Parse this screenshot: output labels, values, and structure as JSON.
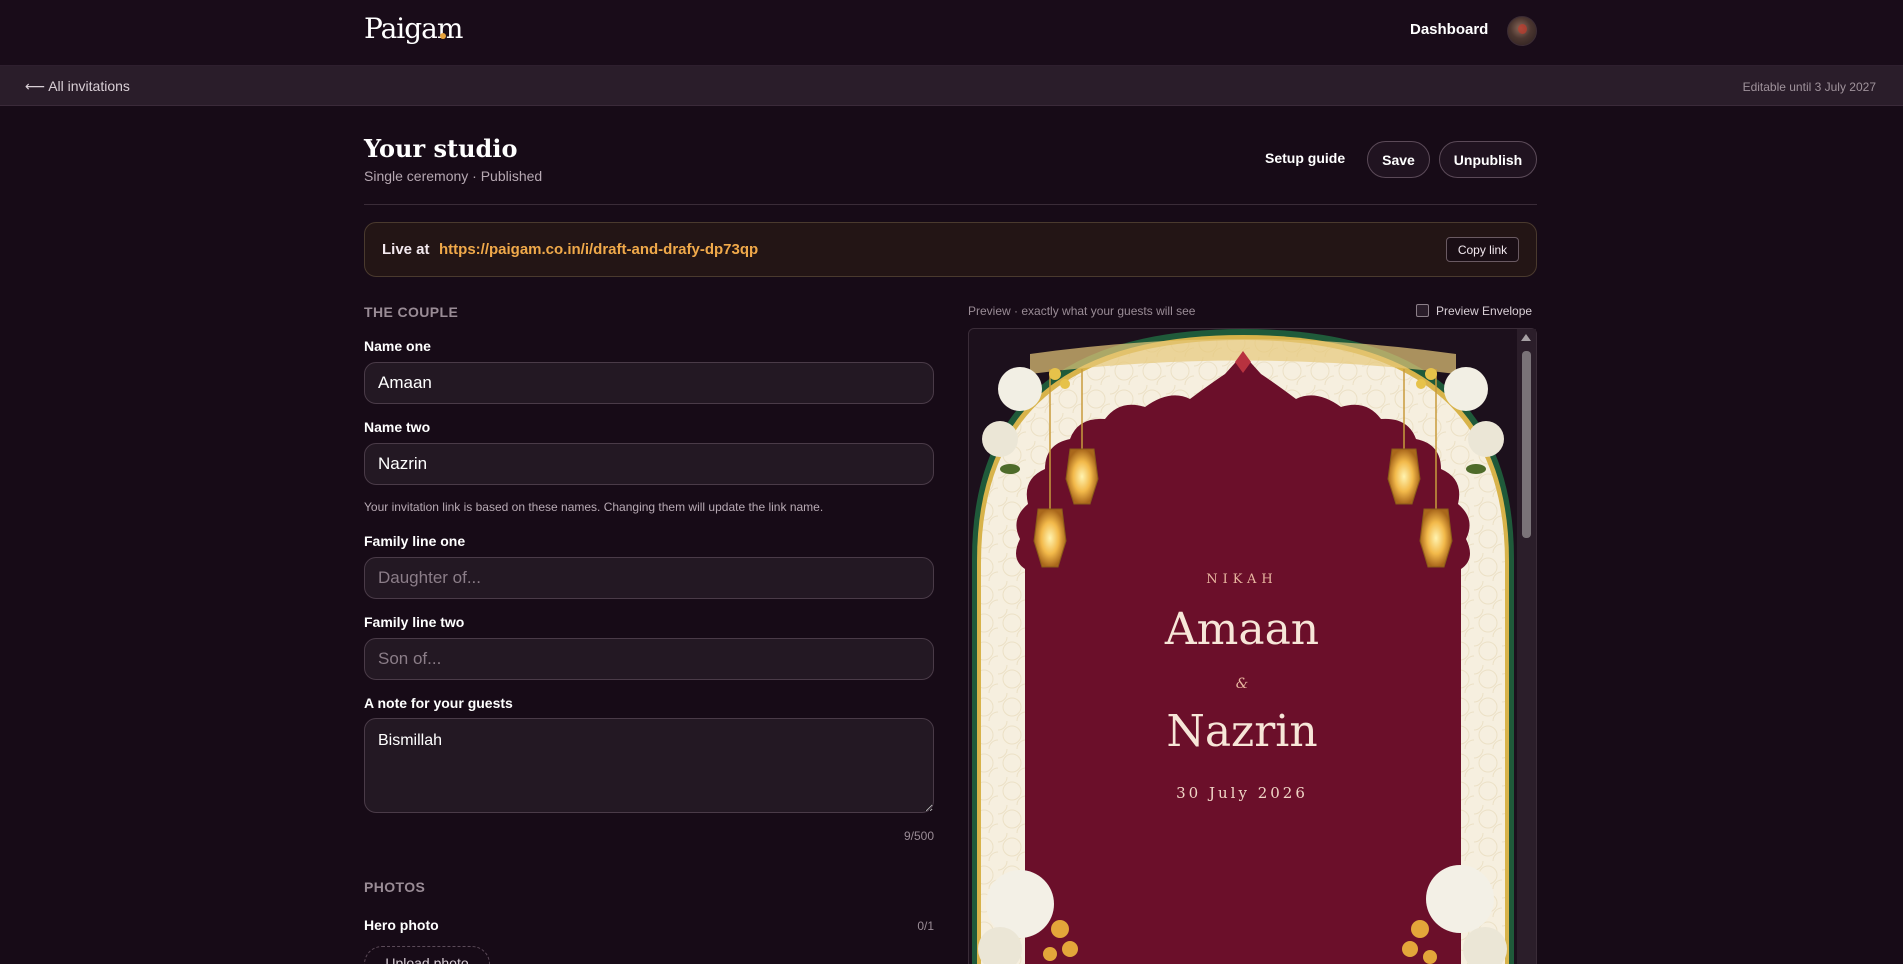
{
  "nav": {
    "logo": "Paigam",
    "dashboard": "Dashboard"
  },
  "subbar": {
    "back": "⟵ All invitations",
    "editable": "Editable until 3 July 2027"
  },
  "header": {
    "title": "Your studio",
    "subtitle": "Single ceremony · Published",
    "setup_guide": "Setup guide",
    "save": "Save",
    "unpublish": "Unpublish"
  },
  "live": {
    "label": "Live at",
    "url": "https://paigam.co.in/i/draft-and-drafy-dp73qp",
    "copy": "Copy link"
  },
  "couple": {
    "heading": "THE COUPLE",
    "name_one_label": "Name one",
    "name_one_value": "Amaan",
    "name_two_label": "Name two",
    "name_two_value": "Nazrin",
    "helper": "Your invitation link is based on these names. Changing them will update the link name.",
    "family_one_label": "Family line one",
    "family_one_placeholder": "Daughter of...",
    "family_two_label": "Family line two",
    "family_two_placeholder": "Son of...",
    "note_label": "A note for your guests",
    "note_value": "Bismillah",
    "note_count": "9/500"
  },
  "photos": {
    "heading": "PHOTOS",
    "hero_label": "Hero photo",
    "hero_count": "0/1",
    "upload": "Upload photo"
  },
  "preview": {
    "caption": "Preview · exactly what your guests will see",
    "envelope_label": "Preview Envelope",
    "envelope_checked": false,
    "ceremony": "NIKAH",
    "name_one": "Amaan",
    "amp": "&",
    "name_two": "Nazrin",
    "date": "30 July 2026"
  },
  "colors": {
    "background": "#170b17",
    "accent": "#f0a94a",
    "card_maroon": "#6b0f2a",
    "card_cream": "#f6efdf",
    "card_border": "#1f5a3a"
  }
}
